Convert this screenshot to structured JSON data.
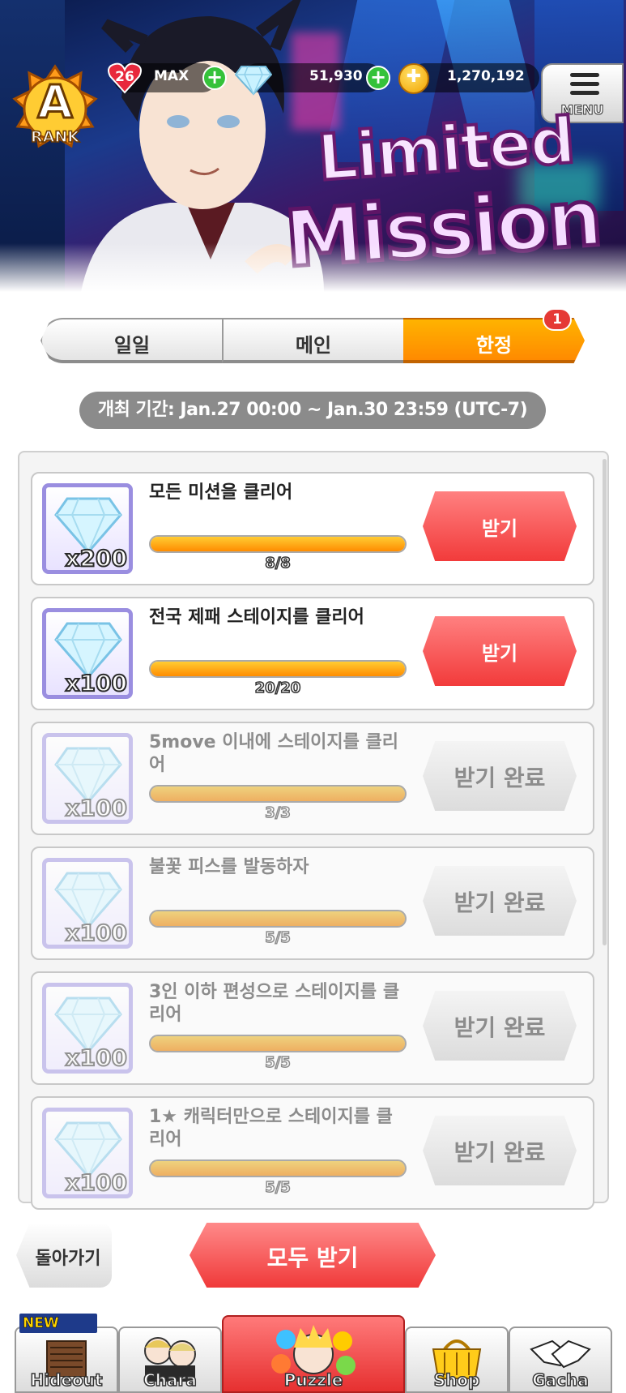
{
  "header": {
    "rank_letter": "A",
    "rank_label": "RANK",
    "stamina": {
      "value": "26",
      "label": "MAX"
    },
    "gems": "51,930",
    "coins": "1,270,192",
    "menu_label": "MENU",
    "title_line1": "Limited",
    "title_line2": "Mission"
  },
  "tabs": [
    {
      "label": "일일",
      "active": false
    },
    {
      "label": "메인",
      "active": false
    },
    {
      "label": "한정",
      "active": true,
      "badge": "1"
    }
  ],
  "period": "개최 기간: Jan.27 00:00 ~ Jan.30 23:59 (UTC-7)",
  "missions": [
    {
      "title": "모든 미션을 클리어",
      "reward": "x200",
      "progress": "8/8",
      "progress_fraction": 1.0,
      "button": "받기",
      "claimed": false
    },
    {
      "title": "전국 제패 스테이지를 클리어",
      "reward": "x100",
      "progress": "20/20",
      "progress_fraction": 1.0,
      "button": "받기",
      "claimed": false
    },
    {
      "title": "5move 이내에 스테이지를 클리어",
      "reward": "x100",
      "progress": "3/3",
      "progress_fraction": 1.0,
      "button": "받기 완료",
      "claimed": true
    },
    {
      "title": "불꽃 피스를 발동하자",
      "reward": "x100",
      "progress": "5/5",
      "progress_fraction": 1.0,
      "button": "받기 완료",
      "claimed": true
    },
    {
      "title": "3인 이하 편성으로 스테이지를 클리어",
      "reward": "x100",
      "progress": "5/5",
      "progress_fraction": 1.0,
      "button": "받기 완료",
      "claimed": true
    },
    {
      "title": "1★ 캐릭터만으로 스테이지를 클리어",
      "reward": "x100",
      "progress": "5/5",
      "progress_fraction": 1.0,
      "button": "받기 완료",
      "claimed": true
    }
  ],
  "buttons": {
    "back": "돌아가기",
    "claim_all": "모두 받기"
  },
  "nav": {
    "new_badge": "NEW",
    "items": [
      {
        "label": "Hideout",
        "icon": "hideout-icon",
        "active": false
      },
      {
        "label": "Chara",
        "icon": "chara-icon",
        "active": false
      },
      {
        "label": "Puzzle",
        "icon": "puzzle-icon",
        "active": true
      },
      {
        "label": "Shop",
        "icon": "shop-icon",
        "active": false
      },
      {
        "label": "Gacha",
        "icon": "gacha-icon",
        "active": false
      }
    ]
  },
  "colors": {
    "accent_orange": "#ff9a00",
    "claim_red": "#f23b3b",
    "progress_orange": "#ffb000"
  }
}
